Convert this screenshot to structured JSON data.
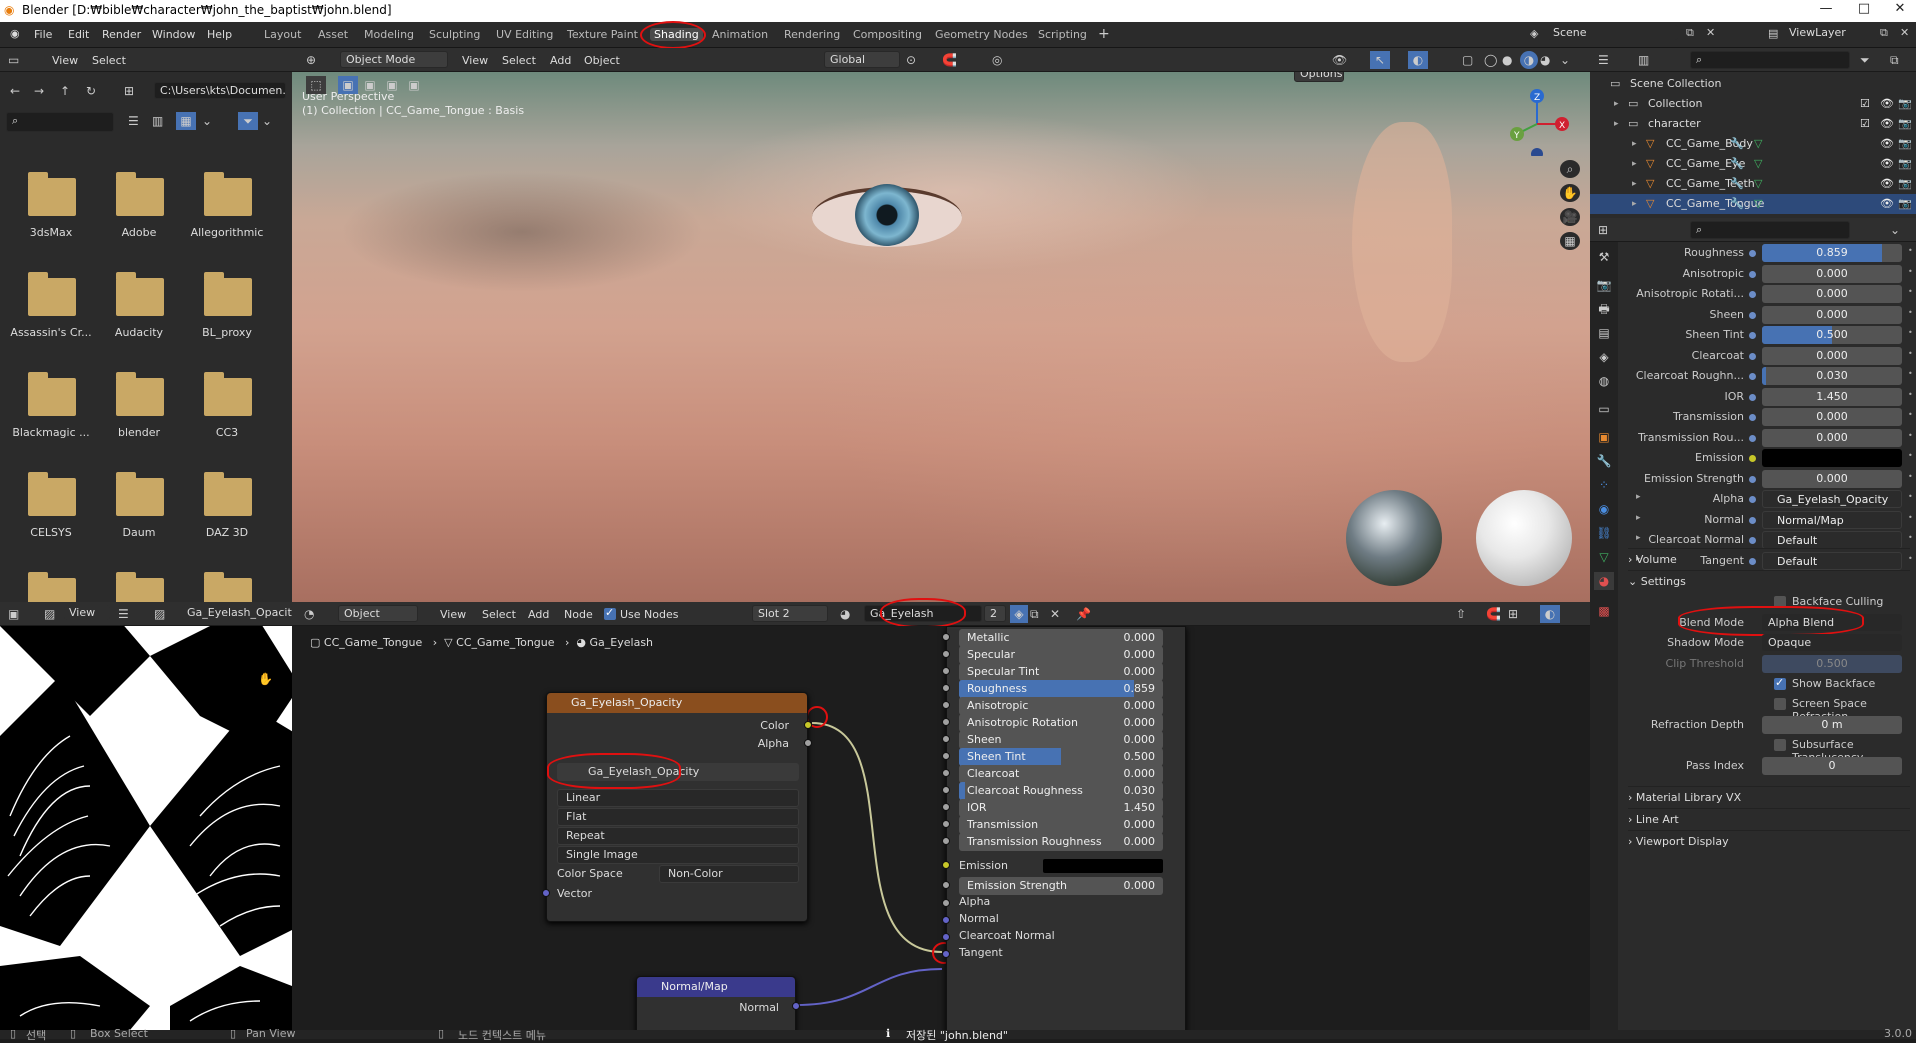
{
  "window": {
    "title": "Blender [D:₩bible₩character₩john_the_baptist₩john.blend]",
    "minimize": "—",
    "maximize": "□",
    "close": "✕"
  },
  "menu": [
    "File",
    "Edit",
    "Render",
    "Window",
    "Help"
  ],
  "workspaces": [
    "Layout",
    "Asset",
    "Modeling",
    "Sculpting",
    "UV Editing",
    "Texture Paint",
    "Shading",
    "Animation",
    "Rendering",
    "Compositing",
    "Geometry Nodes",
    "Scripting"
  ],
  "active_workspace": "Shading",
  "scene": "Scene",
  "view_layer": "ViewLayer",
  "file_browser": {
    "menu": [
      "View",
      "Select"
    ],
    "path": "C:\\Users\\kts\\Documen...",
    "folders": [
      "3dsMax",
      "Adobe",
      "Allegorithmic",
      "Assassin's Cr...",
      "Audacity",
      "BL_proxy",
      "Blackmagic ...",
      "blender",
      "CC3",
      "CELSYS",
      "Daum",
      "DAZ 3D",
      "",
      "",
      ""
    ]
  },
  "viewport": {
    "mode": "Object Mode",
    "menu": [
      "View",
      "Select",
      "Add",
      "Object"
    ],
    "orientation": "Global",
    "options": "Options",
    "overlay_line1": "User Perspective",
    "overlay_line2": "(1) Collection | CC_Game_Tongue : Basis",
    "gizmo": {
      "z": "Z",
      "x": "X",
      "y": "Y"
    }
  },
  "outliner": {
    "rows": [
      {
        "label": "Scene Collection",
        "indent": 0,
        "selected": false
      },
      {
        "label": "Collection",
        "indent": 1,
        "selected": false
      },
      {
        "label": "character",
        "indent": 1,
        "selected": false
      },
      {
        "label": "CC_Game_Body",
        "indent": 2,
        "selected": false
      },
      {
        "label": "CC_Game_Eye",
        "indent": 2,
        "selected": false
      },
      {
        "label": "CC_Game_Teeth",
        "indent": 2,
        "selected": false
      },
      {
        "label": "CC_Game_Tongue",
        "indent": 2,
        "selected": true
      }
    ]
  },
  "properties": {
    "rows": [
      {
        "label": "Roughness",
        "value": "0.859",
        "fill": 0.859,
        "kind": "num"
      },
      {
        "label": "Anisotropic",
        "value": "0.000",
        "fill": 0,
        "kind": "num"
      },
      {
        "label": "Anisotropic Rotati...",
        "value": "0.000",
        "fill": 0,
        "kind": "num"
      },
      {
        "label": "Sheen",
        "value": "0.000",
        "fill": 0,
        "kind": "num"
      },
      {
        "label": "Sheen Tint",
        "value": "0.500",
        "fill": 0.5,
        "kind": "num"
      },
      {
        "label": "Clearcoat",
        "value": "0.000",
        "fill": 0,
        "kind": "num"
      },
      {
        "label": "Clearcoat Roughn...",
        "value": "0.030",
        "fill": 0.03,
        "kind": "num"
      },
      {
        "label": "IOR",
        "value": "1.450",
        "fill": 0,
        "kind": "num"
      },
      {
        "label": "Transmission",
        "value": "0.000",
        "fill": 0,
        "kind": "num"
      },
      {
        "label": "Transmission Rou...",
        "value": "0.000",
        "fill": 0,
        "kind": "num"
      },
      {
        "label": "Emission",
        "value": "",
        "fill": 0,
        "kind": "color"
      },
      {
        "label": "Emission Strength",
        "value": "0.000",
        "fill": 0,
        "kind": "num"
      },
      {
        "label": "Alpha",
        "value": "Ga_Eyelash_Opacity",
        "fill": 0,
        "kind": "link"
      },
      {
        "label": "Normal",
        "value": "Normal/Map",
        "fill": 0,
        "kind": "link"
      },
      {
        "label": "Clearcoat Normal",
        "value": "Default",
        "fill": 0,
        "kind": "link"
      },
      {
        "label": "Tangent",
        "value": "Default",
        "fill": 0,
        "kind": "link"
      }
    ],
    "volume": "Volume",
    "settings": "Settings",
    "backface_culling": "Backface Culling",
    "blend_mode_label": "Blend Mode",
    "blend_mode": "Alpha Blend",
    "shadow_mode_label": "Shadow Mode",
    "shadow_mode": "Opaque",
    "clip_threshold_label": "Clip Threshold",
    "clip_threshold": "0.500",
    "show_backface": "Show Backface",
    "ssr": "Screen Space Refraction",
    "refraction_depth_label": "Refraction Depth",
    "refraction_depth": "0 m",
    "subsurface": "Subsurface Translucency",
    "pass_index_label": "Pass Index",
    "pass_index": "0",
    "material_library": "Material Library VX",
    "line_art": "Line Art",
    "viewport_display": "Viewport Display"
  },
  "image_editor": {
    "view": "View",
    "image": "Ga_Eyelash_Opacity"
  },
  "node_editor": {
    "object": "Object",
    "menu": [
      "View",
      "Select",
      "Add",
      "Node"
    ],
    "use_nodes": "Use Nodes",
    "slot": "Slot 2",
    "material": "Ga_Eyelash",
    "users": "2",
    "breadcrumb": [
      "CC_Game_Tongue",
      "CC_Game_Tongue",
      "Ga_Eyelash"
    ],
    "image_node": {
      "title": "Ga_Eyelash_Opacity",
      "out_color": "Color",
      "out_alpha": "Alpha",
      "image": "Ga_Eyelash_Opacity",
      "interp": "Linear",
      "proj": "Flat",
      "ext": "Repeat",
      "source": "Single Image",
      "cs_label": "Color Space",
      "cs": "Non-Color",
      "vector": "Vector"
    },
    "normal_node": {
      "title": "Normal/Map",
      "out": "Normal"
    },
    "bsdf_rows": [
      {
        "label": "Metallic",
        "value": "0.000",
        "fill": 0
      },
      {
        "label": "Specular",
        "value": "0.000",
        "fill": 0
      },
      {
        "label": "Specular Tint",
        "value": "0.000",
        "fill": 0
      },
      {
        "label": "Roughness",
        "value": "0.859",
        "fill": 0.859
      },
      {
        "label": "Anisotropic",
        "value": "0.000",
        "fill": 0
      },
      {
        "label": "Anisotropic Rotation",
        "value": "0.000",
        "fill": 0
      },
      {
        "label": "Sheen",
        "value": "0.000",
        "fill": 0
      },
      {
        "label": "Sheen Tint",
        "value": "0.500",
        "fill": 0.5
      },
      {
        "label": "Clearcoat",
        "value": "0.000",
        "fill": 0
      },
      {
        "label": "Clearcoat Roughness",
        "value": "0.030",
        "fill": 0.03
      },
      {
        "label": "IOR",
        "value": "1.450",
        "fill": 0
      },
      {
        "label": "Transmission",
        "value": "0.000",
        "fill": 0
      },
      {
        "label": "Transmission Roughness",
        "value": "0.000",
        "fill": 0
      }
    ],
    "emission": "Emission",
    "emission_strength": "Emission Strength",
    "emission_strength_value": "0.000",
    "alpha": "Alpha",
    "normal": "Normal",
    "clearcoat_normal": "Clearcoat Normal",
    "tangent": "Tangent"
  },
  "status": {
    "select": "선택",
    "box_select": "Box Select",
    "pan_view": "Pan View",
    "context_menu": "노드 컨텍스트 메뉴",
    "saved": "저장된 \"john.blend\"",
    "version": "3.0.0"
  },
  "colors": {
    "accent": "#4772b3",
    "node_image_header": "#8a4e1e",
    "node_vector_header": "#3a3a8c",
    "annotation": "#e01010"
  }
}
